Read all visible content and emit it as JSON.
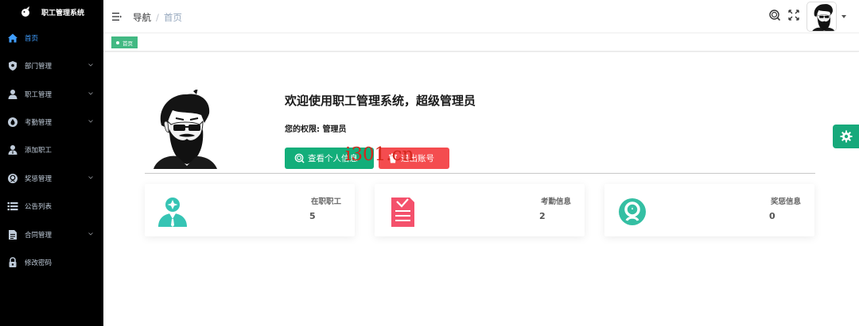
{
  "brand": {
    "title": "职工管理系统"
  },
  "sidebar": {
    "items": [
      {
        "label": "首页",
        "icon": "home-icon",
        "has_children": false,
        "active": true
      },
      {
        "label": "部门管理",
        "icon": "shield-icon",
        "has_children": true,
        "active": false
      },
      {
        "label": "职工管理",
        "icon": "user-icon",
        "has_children": true,
        "active": false
      },
      {
        "label": "考勤管理",
        "icon": "drop-icon",
        "has_children": true,
        "active": false
      },
      {
        "label": "添加职工",
        "icon": "user-add-icon",
        "has_children": false,
        "active": false
      },
      {
        "label": "奖惩管理",
        "icon": "award-icon",
        "has_children": true,
        "active": false
      },
      {
        "label": "公告列表",
        "icon": "list-icon",
        "has_children": false,
        "active": false
      },
      {
        "label": "合同管理",
        "icon": "document-icon",
        "has_children": true,
        "active": false
      },
      {
        "label": "修改密码",
        "icon": "lock-icon",
        "has_children": false,
        "active": false
      }
    ]
  },
  "header": {
    "breadcrumb": {
      "root": "导航",
      "separator": "/",
      "current": "首页"
    }
  },
  "tags": [
    {
      "label": "首页"
    }
  ],
  "main": {
    "welcome": "欢迎使用职工管理系统，超级管理员",
    "permission": "您的权限: 管理员",
    "buttons": {
      "info": "查看个人信息",
      "logout": "退出账号"
    },
    "watermark": "i301.cn",
    "cards": [
      {
        "label": "在职职工",
        "value": "5",
        "icon": "employee-icon",
        "color": "#36c4b4"
      },
      {
        "label": "考勤信息",
        "value": "2",
        "icon": "attendance-doc-icon",
        "color": "#f4516c"
      },
      {
        "label": "奖惩信息",
        "value": "0",
        "icon": "reward-icon",
        "color": "#34bfa3"
      }
    ]
  },
  "colors": {
    "sidebar_bg": "#000000",
    "active": "#409eff",
    "primary_green": "#13ae7a",
    "danger": "#f44c4f",
    "tag_green": "#42b983"
  }
}
